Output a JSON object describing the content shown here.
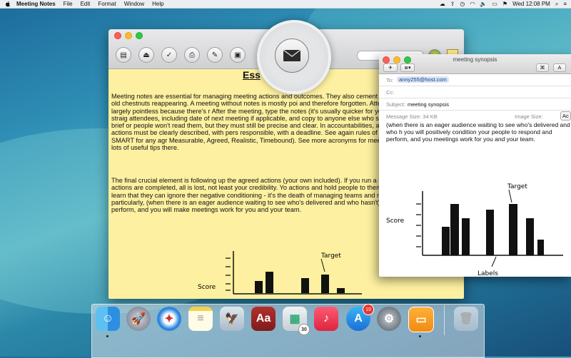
{
  "menubar": {
    "app_name": "Meeting Notes",
    "items": [
      "File",
      "Edit",
      "Format",
      "Window",
      "Help"
    ],
    "clock": "Wed 12:08 PM",
    "battery": "-"
  },
  "note_window": {
    "toolbar_buttons": [
      "document-icon",
      "eject-icon",
      "checkmark-icon",
      "printer-icon",
      "brush-icon",
      "photo-icon",
      "share-icon"
    ],
    "heading": "Ess",
    "paragraphs": [
      "Meeting notes are essential for managing meeting actions and outcomes. They also cement agr confusions. They also prevent old chestnuts reappearing. A meeting without notes is mostly poi and therefore forgotten. Attendees feel that the meeting was largely pointless because there's r After the meeting, type the notes (it's usually quicker for you to do it), and circulate them straig attendees, including date of next meeting if applicable, and copy to anyone else who should see The notes should be brief or people won't read them, but they must still be precise and clear. In accountabilities, actions and timescales. Any agreed actions must be clearly described, with pers responsible, with a deadline. See again rules of delegation. Use the acronym SMART for any agr Measurable, Agreed, Realistic, Timebound). See more acronyms for meetings and training sessi there are lots of useful tips there.",
      "The final crucial element is following up the agreed actions (your own included). If you run a gr notes, and then fail to ensure the actions are completed, all is lost, not least your credibility. Yo actions and hold people to them. If you don't they will very soon learn that they can ignore ther negative conditioning - it's the death of managing teams and results. By following up agreed ac particularly, (when there is an eager audience waiting to see who's delivered and who hasn't), y your people to respond and perform, and you will make meetings work for you and your team."
    ],
    "sketch": {
      "score_label": "Score",
      "target_label": "Target"
    }
  },
  "magnifier": {
    "icon": "envelope-icon"
  },
  "mail_window": {
    "title": "meeting synopsis",
    "to_label": "To:",
    "to_value": "anny255@host.com",
    "cc_label": "Cc:",
    "subject_label": "Subject:",
    "subject_value": "meeting synopsis",
    "message_size": "Message Size: 34 KB",
    "image_size_label": "Image Size:",
    "image_size_value": "Ac",
    "format_button": "A",
    "body_text": "(when there is an eager audience waiting to see who's delivered and who h you will positively condition your people to respond and perform, and you meetings work for you and your team.",
    "sketch": {
      "score_label": "Score",
      "target_label": "Target",
      "labels_label": "Labels"
    }
  },
  "dock": {
    "apps": [
      "Finder",
      "Launchpad",
      "Safari",
      "Notes",
      "Mail",
      "Dictionary",
      "Preview",
      "iTunes",
      "App Store",
      "System Preferences",
      "Meeting Notes",
      "Trash"
    ],
    "app_store_badge": "19",
    "calendar_badge": "30"
  }
}
